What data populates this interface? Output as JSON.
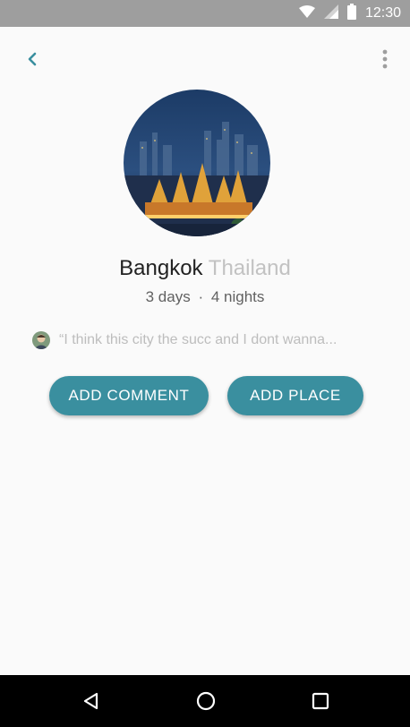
{
  "status_bar": {
    "time": "12:30",
    "icons": [
      "wifi-icon",
      "cell-signal-icon",
      "battery-icon"
    ],
    "background": "#9e9e9e"
  },
  "header": {
    "back_icon": "chevron-left-icon",
    "more_icon": "more-vert-icon",
    "accent": "#3a8f9f"
  },
  "trip": {
    "city": "Bangkok",
    "country": "Thailand",
    "days": "3 days",
    "separator": "·",
    "nights": "4 nights",
    "image_icon": "bangkok-city-photo"
  },
  "comment": {
    "text": "“I think this city the succ and I dont wanna..."
  },
  "actions": {
    "add_comment": "ADD COMMENT",
    "add_place": "ADD PLACE"
  },
  "navigation": {
    "icons": [
      "back-triangle-icon",
      "home-circle-icon",
      "recents-square-icon"
    ]
  }
}
